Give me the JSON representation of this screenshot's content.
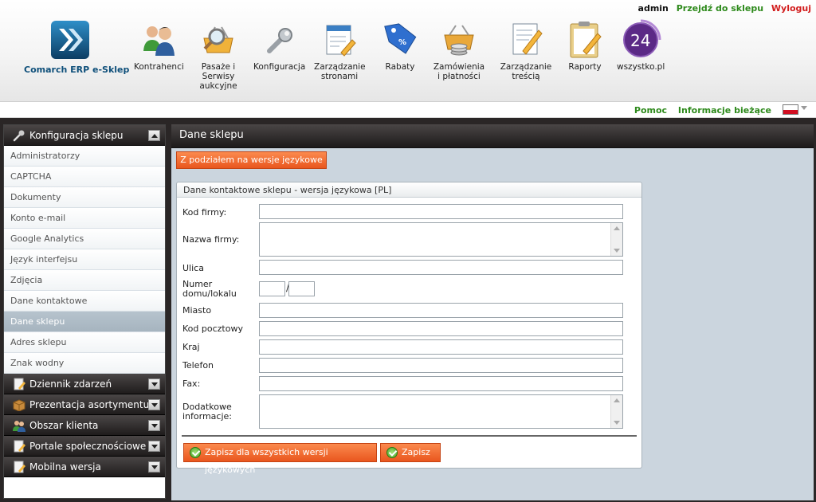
{
  "top_links": {
    "user": "admin",
    "go_to_shop": "Przejdź do sklepu",
    "logout": "Wyloguj"
  },
  "logo": {
    "name": "Comarch ERP e-Sklep"
  },
  "nav": [
    {
      "label": "Kontrahenci",
      "icon": "users-icon"
    },
    {
      "label": "Pasaże i Serwisy aukcyjne",
      "icon": "basket-magnifier-icon"
    },
    {
      "label": "Konfiguracja",
      "icon": "wrench-icon"
    },
    {
      "label": "Zarządzanie stronami",
      "icon": "page-edit-icon"
    },
    {
      "label": "Rabaty",
      "icon": "discount-tag-icon"
    },
    {
      "label": "Zamówienia i płatności",
      "icon": "basket-coins-icon"
    },
    {
      "label": "Zarządzanie treścią",
      "icon": "content-edit-icon"
    },
    {
      "label": "Raporty",
      "icon": "clipboard-icon"
    },
    {
      "label": "wszystko.pl",
      "icon": "wszystko-24-icon",
      "badge": "24"
    }
  ],
  "subbar": {
    "help": "Pomoc",
    "news": "Informacje bieżące"
  },
  "sidebar": {
    "config_header": "Konfiguracja sklepu",
    "items": [
      "Administratorzy",
      "CAPTCHA",
      "Dokumenty",
      "Konto e-mail",
      "Google Analytics",
      "Język interfejsu",
      "Zdjęcia",
      "Dane kontaktowe",
      "Dane sklepu",
      "Adres sklepu",
      "Znak wodny"
    ],
    "active_item": "Dane sklepu",
    "sections": [
      "Dziennik zdarzeń",
      "Prezentacja asortymentu",
      "Obszar klienta",
      "Portale społecznościowe",
      "Mobilna wersja"
    ]
  },
  "main": {
    "title": "Dane sklepu",
    "split_button": "Z podziałem na wersje językowe",
    "panel_title": "Dane kontaktowe sklepu - wersja językowa [PL]",
    "labels": {
      "company_code": "Kod firmy:",
      "company_name": "Nazwa firmy:",
      "street": "Ulica",
      "house_number": "Numer domu/lokalu",
      "city": "Miasto",
      "postal_code": "Kod pocztowy",
      "country": "Kraj",
      "phone": "Telefon",
      "fax": "Fax:",
      "additional": "Dodatkowe informacje:"
    },
    "separator": "/",
    "save_all": "Zapisz dla wszystkich wersji językowych",
    "save": "Zapisz"
  },
  "colors": {
    "accent_orange": "#f06a30",
    "link_green": "#2e8a1c",
    "logout_red": "#d21d1d",
    "header_dark": "#2a2626"
  }
}
